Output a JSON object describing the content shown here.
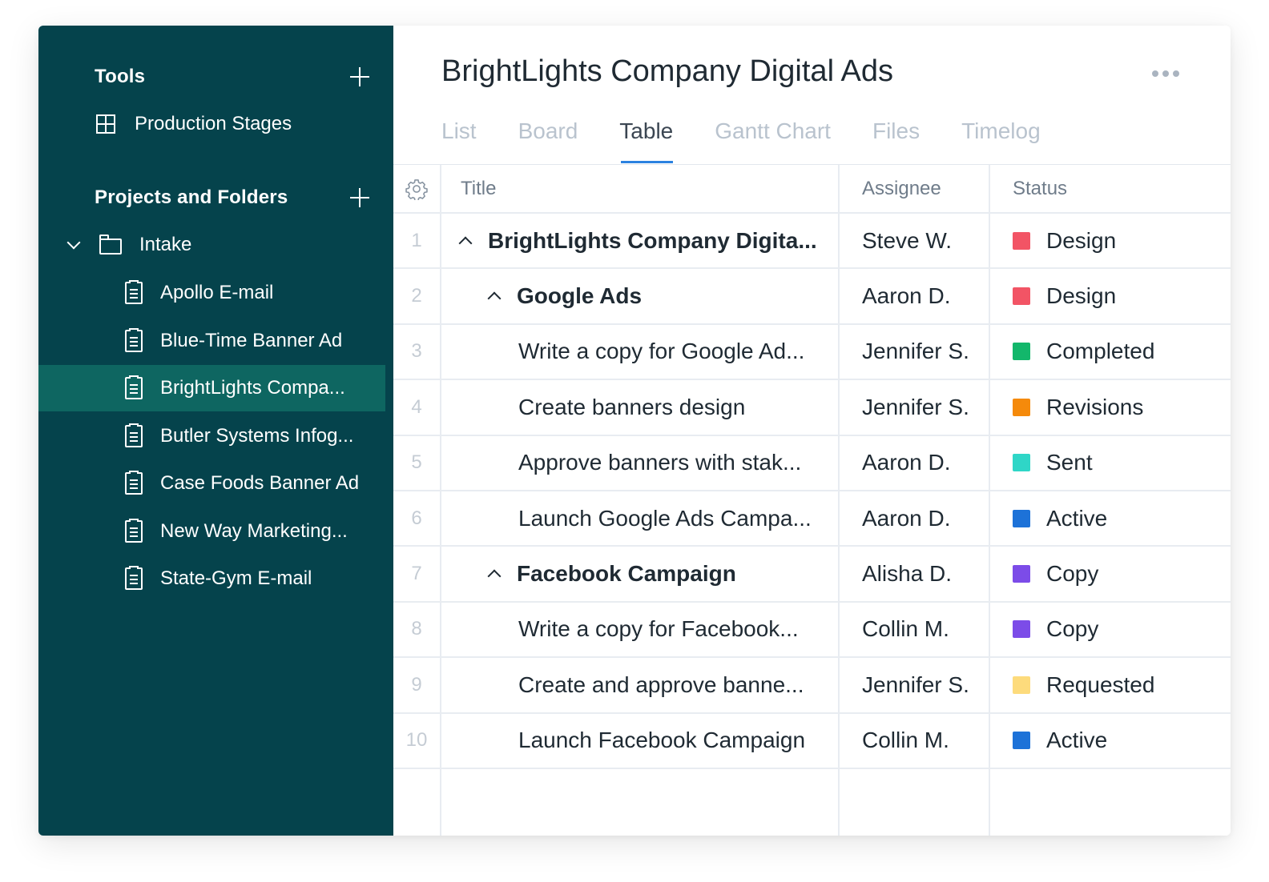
{
  "sidebar": {
    "tools_label": "Tools",
    "tools_items": [
      {
        "label": "Production Stages",
        "icon": "board-icon"
      }
    ],
    "projects_label": "Projects and Folders",
    "folder": {
      "label": "Intake",
      "icon": "folder-icon",
      "expanded": true
    },
    "items": [
      {
        "label": "Apollo E-mail",
        "active": false
      },
      {
        "label": "Blue-Time Banner Ad",
        "active": false
      },
      {
        "label": "BrightLights Compa...",
        "active": true
      },
      {
        "label": "Butler Systems Infog...",
        "active": false
      },
      {
        "label": "Case Foods Banner Ad",
        "active": false
      },
      {
        "label": "New Way Marketing...",
        "active": false
      },
      {
        "label": "State-Gym E-mail",
        "active": false
      }
    ]
  },
  "main": {
    "title": "BrightLights Company Digital Ads",
    "tabs": [
      "List",
      "Board",
      "Table",
      "Gantt Chart",
      "Files",
      "Timelog"
    ],
    "active_tab": "Table"
  },
  "table": {
    "headers": {
      "title": "Title",
      "assignee": "Assignee",
      "status": "Status"
    },
    "rows": [
      {
        "num": "1",
        "title": "BrightLights Company Digita...",
        "assignee": "Steve W.",
        "status": "Design",
        "color": "#f25465",
        "level": 0,
        "group": true
      },
      {
        "num": "2",
        "title": "Google Ads",
        "assignee": "Aaron D.",
        "status": "Design",
        "color": "#f25465",
        "level": 1,
        "group": true
      },
      {
        "num": "3",
        "title": "Write a copy for Google Ad...",
        "assignee": "Jennifer S.",
        "status": "Completed",
        "color": "#13b76b",
        "level": 2,
        "group": false
      },
      {
        "num": "4",
        "title": "Create banners design",
        "assignee": "Jennifer S.",
        "status": "Revisions",
        "color": "#f58a0b",
        "level": 2,
        "group": false
      },
      {
        "num": "5",
        "title": "Approve banners with stak...",
        "assignee": "Aaron D.",
        "status": "Sent",
        "color": "#2fd6c7",
        "level": 2,
        "group": false
      },
      {
        "num": "6",
        "title": "Launch Google Ads Campa...",
        "assignee": "Aaron D.",
        "status": "Active",
        "color": "#1d72d8",
        "level": 2,
        "group": false
      },
      {
        "num": "7",
        "title": "Facebook Campaign",
        "assignee": "Alisha D.",
        "status": "Copy",
        "color": "#7c4ce8",
        "level": 1,
        "group": true
      },
      {
        "num": "8",
        "title": "Write a copy for Facebook...",
        "assignee": "Collin M.",
        "status": "Copy",
        "color": "#7c4ce8",
        "level": 2,
        "group": false
      },
      {
        "num": "9",
        "title": "Create and approve banne...",
        "assignee": "Jennifer S.",
        "status": "Requested",
        "color": "#fddb7c",
        "level": 2,
        "group": false
      },
      {
        "num": "10",
        "title": "Launch Facebook Campaign",
        "assignee": "Collin M.",
        "status": "Active",
        "color": "#1d72d8",
        "level": 2,
        "group": false
      }
    ]
  }
}
